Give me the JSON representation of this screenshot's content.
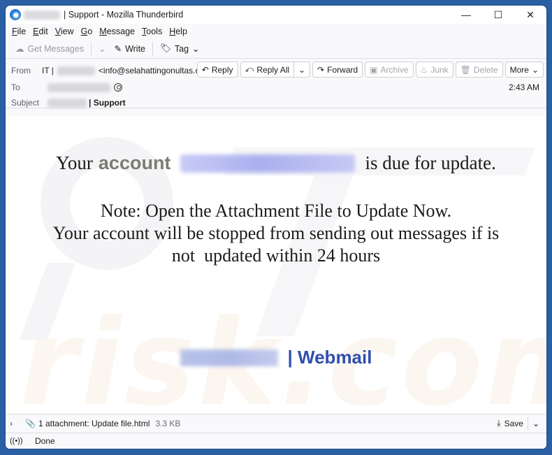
{
  "window": {
    "title": "| Support - Mozilla Thunderbird",
    "controls": {
      "minimize": "—",
      "maximize": "☐",
      "close": "✕"
    }
  },
  "menu": [
    {
      "label": "File",
      "accel": "F",
      "rest": "ile"
    },
    {
      "label": "Edit",
      "accel": "E",
      "rest": "dit"
    },
    {
      "label": "View",
      "accel": "V",
      "rest": "iew"
    },
    {
      "label": "Go",
      "accel": "G",
      "rest": "o"
    },
    {
      "label": "Message",
      "accel": "M",
      "rest": "essage"
    },
    {
      "label": "Tools",
      "accel": "T",
      "rest": "ools"
    },
    {
      "label": "Help",
      "accel": "H",
      "rest": "elp"
    }
  ],
  "toolbar": {
    "get_messages": "Get Messages",
    "write": "Write",
    "tag": "Tag"
  },
  "header": {
    "from_label": "From",
    "from_name_prefix": "IT |",
    "from_email": "<info@selahattingonultas.com.tr>",
    "to_label": "To",
    "subject_label": "Subject",
    "subject_suffix": "| Support",
    "time": "2:43 AM",
    "actions": {
      "reply": "Reply",
      "reply_all": "Reply All",
      "forward": "Forward",
      "archive": "Archive",
      "junk": "Junk",
      "delete": "Delete",
      "more": "More"
    }
  },
  "body": {
    "line1_your": "Your",
    "line1_account": "account",
    "line1_rest": "is due for update.",
    "note": "Note: Open the Attachment File to Update Now.",
    "warning_1": "Your account will be stopped from sending out messages if is",
    "warning_2": "not  updated within 24 hours",
    "signature": "| Webmail",
    "colors": {
      "account_word": "#7c7c74",
      "signature": "#2f4fae"
    }
  },
  "attachment": {
    "summary": "1 attachment: Update file.html",
    "size": "3.3 KB",
    "save": "Save"
  },
  "status": {
    "text": "Done"
  }
}
